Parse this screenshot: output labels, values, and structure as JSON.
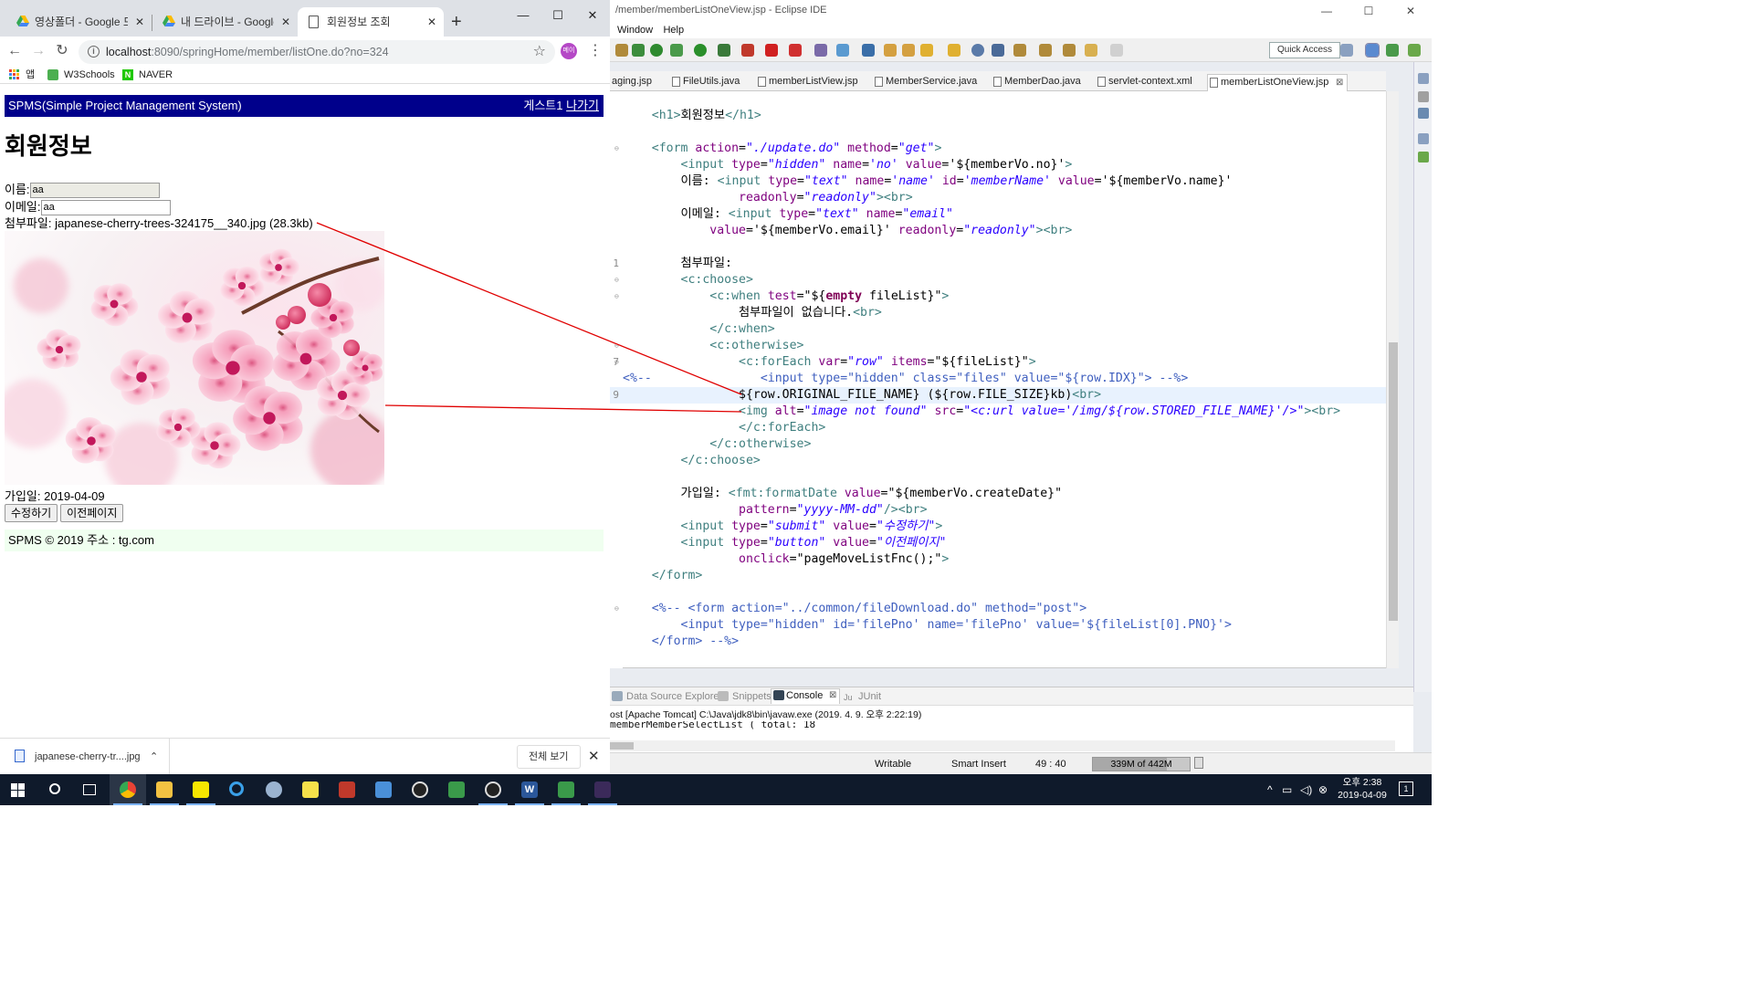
{
  "eclipse": {
    "window_title": "/member/memberListOneView.jsp - Eclipse IDE",
    "menu": [
      "Window",
      "Help"
    ],
    "quick_access": "Quick Access",
    "editor_tabs": [
      "aging.jsp",
      "FileUtils.java",
      "memberListView.jsp",
      "MemberService.java",
      "MemberDao.java",
      "servlet-context.xml",
      "memberListOneView.jsp"
    ],
    "code_lines": [
      {
        "num": "",
        "fold": false,
        "cur": false,
        "segs": [
          [
            "    ",
            "t-el"
          ],
          [
            "<h1>",
            "t-tag"
          ],
          [
            "회원정보",
            "t-el"
          ],
          [
            "</h1>",
            "t-tag"
          ]
        ]
      },
      {
        "num": "",
        "fold": false,
        "cur": false,
        "segs": []
      },
      {
        "num": "",
        "fold": true,
        "cur": false,
        "segs": [
          [
            "    ",
            "t-el"
          ],
          [
            "<form ",
            "t-tag"
          ],
          [
            "action",
            "t-attr"
          ],
          [
            "=",
            "t-el"
          ],
          [
            "\"./update.do\"",
            "t-str"
          ],
          [
            " method",
            "t-attr"
          ],
          [
            "=",
            "t-el"
          ],
          [
            "\"get\"",
            "t-str"
          ],
          [
            ">",
            "t-tag"
          ]
        ]
      },
      {
        "num": "",
        "fold": false,
        "cur": false,
        "segs": [
          [
            "        ",
            "t-el"
          ],
          [
            "<input ",
            "t-tag"
          ],
          [
            "type",
            "t-attr"
          ],
          [
            "=",
            "t-el"
          ],
          [
            "\"hidden\"",
            "t-str"
          ],
          [
            " name",
            "t-attr"
          ],
          [
            "=",
            "t-el"
          ],
          [
            "'no'",
            "t-str"
          ],
          [
            " value",
            "t-attr"
          ],
          [
            "=",
            "t-el"
          ],
          [
            "'${memberVo.no}'",
            "t-el"
          ],
          [
            ">",
            "t-tag"
          ]
        ]
      },
      {
        "num": "",
        "fold": false,
        "cur": false,
        "segs": [
          [
            "        이름: ",
            "t-el"
          ],
          [
            "<input ",
            "t-tag"
          ],
          [
            "type",
            "t-attr"
          ],
          [
            "=",
            "t-el"
          ],
          [
            "\"text\"",
            "t-str"
          ],
          [
            " name",
            "t-attr"
          ],
          [
            "=",
            "t-el"
          ],
          [
            "'name'",
            "t-str"
          ],
          [
            " id",
            "t-attr"
          ],
          [
            "=",
            "t-el"
          ],
          [
            "'memberName'",
            "t-str"
          ],
          [
            " value",
            "t-attr"
          ],
          [
            "=",
            "t-el"
          ],
          [
            "'${memberVo.name}'",
            "t-el"
          ]
        ]
      },
      {
        "num": "",
        "fold": false,
        "cur": false,
        "segs": [
          [
            "                ",
            "t-el"
          ],
          [
            "readonly",
            "t-attr"
          ],
          [
            "=",
            "t-el"
          ],
          [
            "\"readonly\"",
            "t-str"
          ],
          [
            ">",
            "t-tag"
          ],
          [
            "<br>",
            "t-tag"
          ]
        ]
      },
      {
        "num": "",
        "fold": false,
        "cur": false,
        "segs": [
          [
            "        이메일: ",
            "t-el"
          ],
          [
            "<input ",
            "t-tag"
          ],
          [
            "type",
            "t-attr"
          ],
          [
            "=",
            "t-el"
          ],
          [
            "\"text\"",
            "t-str"
          ],
          [
            " name",
            "t-attr"
          ],
          [
            "=",
            "t-el"
          ],
          [
            "\"email\"",
            "t-str"
          ]
        ]
      },
      {
        "num": "",
        "fold": false,
        "cur": false,
        "segs": [
          [
            "            ",
            "t-el"
          ],
          [
            "value",
            "t-attr"
          ],
          [
            "=",
            "t-el"
          ],
          [
            "'${memberVo.email}'",
            "t-el"
          ],
          [
            " readonly",
            "t-attr"
          ],
          [
            "=",
            "t-el"
          ],
          [
            "\"readonly\"",
            "t-str"
          ],
          [
            ">",
            "t-tag"
          ],
          [
            "<br>",
            "t-tag"
          ]
        ]
      },
      {
        "num": "",
        "fold": false,
        "cur": false,
        "segs": []
      },
      {
        "num": "1",
        "fold": false,
        "cur": false,
        "segs": [
          [
            "        첨부파일:",
            "t-el"
          ]
        ]
      },
      {
        "num": "",
        "fold": true,
        "cur": false,
        "segs": [
          [
            "        ",
            "t-el"
          ],
          [
            "<c:choose>",
            "t-tag"
          ]
        ]
      },
      {
        "num": "",
        "fold": true,
        "cur": false,
        "segs": [
          [
            "            ",
            "t-el"
          ],
          [
            "<c:when ",
            "t-tag"
          ],
          [
            "test",
            "t-attr"
          ],
          [
            "=",
            "t-el"
          ],
          [
            "\"${",
            "t-el"
          ],
          [
            "empty",
            "t-kw"
          ],
          [
            " fileList}\"",
            "t-el"
          ],
          [
            ">",
            "t-tag"
          ]
        ]
      },
      {
        "num": "",
        "fold": false,
        "cur": false,
        "segs": [
          [
            "                첨부파일이 없습니다.",
            "t-el"
          ],
          [
            "<br>",
            "t-tag"
          ]
        ]
      },
      {
        "num": "",
        "fold": false,
        "cur": false,
        "segs": [
          [
            "            ",
            "t-el"
          ],
          [
            "</c:when>",
            "t-tag"
          ]
        ]
      },
      {
        "num": "",
        "fold": true,
        "cur": false,
        "segs": [
          [
            "            ",
            "t-el"
          ],
          [
            "<c:otherwise>",
            "t-tag"
          ]
        ]
      },
      {
        "num": "7",
        "fold": true,
        "cur": false,
        "segs": [
          [
            "                ",
            "t-el"
          ],
          [
            "<c:forEach ",
            "t-tag"
          ],
          [
            "var",
            "t-attr"
          ],
          [
            "=",
            "t-el"
          ],
          [
            "\"row\"",
            "t-str"
          ],
          [
            " items",
            "t-attr"
          ],
          [
            "=",
            "t-el"
          ],
          [
            "\"${fileList}\"",
            "t-el"
          ],
          [
            ">",
            "t-tag"
          ]
        ]
      },
      {
        "num": "",
        "fold": false,
        "cur": false,
        "segs": [
          [
            "<%--               ",
            "t-cm"
          ],
          [
            "<input type=\"hidden\" class=\"files\" value=\"${row.IDX}\"> --%>",
            "t-cm"
          ]
        ]
      },
      {
        "num": "9",
        "fold": false,
        "cur": true,
        "segs": [
          [
            "                ",
            "t-el"
          ],
          [
            "${row.ORIGINAL_FILE_NAME} (${row.FILE_SIZE}kb)",
            "t-el"
          ],
          [
            "<br>",
            "t-tag"
          ]
        ]
      },
      {
        "num": "",
        "fold": false,
        "cur": false,
        "segs": [
          [
            "                ",
            "t-el"
          ],
          [
            "<img ",
            "t-tag"
          ],
          [
            "alt",
            "t-attr"
          ],
          [
            "=",
            "t-el"
          ],
          [
            "\"image not found\"",
            "t-str"
          ],
          [
            " src",
            "t-attr"
          ],
          [
            "=",
            "t-el"
          ],
          [
            "\"<c:url value='/img/${row.STORED_FILE_NAME}'/>\"",
            "t-str"
          ],
          [
            "><br>",
            "t-tag"
          ]
        ]
      },
      {
        "num": "",
        "fold": false,
        "cur": false,
        "segs": [
          [
            "                ",
            "t-el"
          ],
          [
            "</c:forEach>",
            "t-tag"
          ]
        ]
      },
      {
        "num": "",
        "fold": false,
        "cur": false,
        "segs": [
          [
            "            ",
            "t-el"
          ],
          [
            "</c:otherwise>",
            "t-tag"
          ]
        ]
      },
      {
        "num": "",
        "fold": false,
        "cur": false,
        "segs": [
          [
            "        ",
            "t-el"
          ],
          [
            "</c:choose>",
            "t-tag"
          ]
        ]
      },
      {
        "num": "",
        "fold": false,
        "cur": false,
        "segs": []
      },
      {
        "num": "",
        "fold": false,
        "cur": false,
        "segs": [
          [
            "        가입일: ",
            "t-el"
          ],
          [
            "<fmt:formatDate ",
            "t-tag"
          ],
          [
            "value",
            "t-attr"
          ],
          [
            "=",
            "t-el"
          ],
          [
            "\"${memberVo.createDate}\"",
            "t-el"
          ]
        ]
      },
      {
        "num": "",
        "fold": false,
        "cur": false,
        "segs": [
          [
            "                ",
            "t-el"
          ],
          [
            "pattern",
            "t-attr"
          ],
          [
            "=",
            "t-el"
          ],
          [
            "\"yyyy-MM-dd\"",
            "t-str"
          ],
          [
            "/>",
            "t-tag"
          ],
          [
            "<br>",
            "t-tag"
          ]
        ]
      },
      {
        "num": "",
        "fold": false,
        "cur": false,
        "segs": [
          [
            "        ",
            "t-el"
          ],
          [
            "<input ",
            "t-tag"
          ],
          [
            "type",
            "t-attr"
          ],
          [
            "=",
            "t-el"
          ],
          [
            "\"submit\"",
            "t-str"
          ],
          [
            " value",
            "t-attr"
          ],
          [
            "=",
            "t-el"
          ],
          [
            "\"수정하기\"",
            "t-str"
          ],
          [
            ">",
            "t-tag"
          ]
        ]
      },
      {
        "num": "",
        "fold": false,
        "cur": false,
        "segs": [
          [
            "        ",
            "t-el"
          ],
          [
            "<input ",
            "t-tag"
          ],
          [
            "type",
            "t-attr"
          ],
          [
            "=",
            "t-el"
          ],
          [
            "\"button\"",
            "t-str"
          ],
          [
            " value",
            "t-attr"
          ],
          [
            "=",
            "t-el"
          ],
          [
            "\"이전페이지\"",
            "t-str"
          ]
        ]
      },
      {
        "num": "",
        "fold": false,
        "cur": false,
        "segs": [
          [
            "                ",
            "t-el"
          ],
          [
            "onclick",
            "t-attr"
          ],
          [
            "=",
            "t-el"
          ],
          [
            "\"pageMoveListFnc();\"",
            "t-el"
          ],
          [
            ">",
            "t-tag"
          ]
        ]
      },
      {
        "num": "",
        "fold": false,
        "cur": false,
        "segs": [
          [
            "    ",
            "t-el"
          ],
          [
            "</form>",
            "t-tag"
          ]
        ]
      },
      {
        "num": "",
        "fold": false,
        "cur": false,
        "segs": []
      },
      {
        "num": "",
        "fold": true,
        "cur": false,
        "segs": [
          [
            "    ",
            "t-el"
          ],
          [
            "<%-- <form action=\"../common/fileDownload.do\" method=\"post\">",
            "t-cm"
          ]
        ]
      },
      {
        "num": "",
        "fold": false,
        "cur": false,
        "segs": [
          [
            "        ",
            "t-el"
          ],
          [
            "<input type=\"hidden\" id='filePno' name='filePno' value='${fileList[0].PNO}'>",
            "t-cm"
          ]
        ]
      },
      {
        "num": "",
        "fold": false,
        "cur": false,
        "segs": [
          [
            "    ",
            "t-el"
          ],
          [
            "</form> --%>",
            "t-cm"
          ]
        ]
      }
    ],
    "console": {
      "tabs": [
        "Data Source Explorer",
        "Snippets",
        "Console",
        "JUnit"
      ],
      "process": "ost [Apache Tomcat] C:\\Java\\jdk8\\bin\\javaw.exe (2019. 4. 9. 오후 2:22:19)",
      "output": "memberMemberSelectList   (       total: 18"
    },
    "status": {
      "writable": "Writable",
      "insert_mode": "Smart Insert",
      "cursor": "49 : 40",
      "heap": "339M of 442M",
      "heap_used_fraction": 0.767
    }
  },
  "chrome": {
    "tabs": [
      "영상폴더 - Google 드라이브",
      "내 드라이브 - Google 드라이브",
      "회원정보 조회"
    ],
    "url_host": "localhost",
    "url_rest": ":8090/springHome/member/listOne.do?no=324",
    "profile_initial": "메이",
    "bookmarks": [
      "앱",
      "W3Schools",
      "NAVER"
    ],
    "page": {
      "header_brand": "SPMS(Simple Project Management System)",
      "header_user": "게스트1",
      "header_logout": "나가기",
      "title": "회원정보",
      "name_label": "이름:",
      "name_value": "aa",
      "email_label": "이메일:",
      "email_value": "aa",
      "attach_label": "첨부파일:",
      "attach_text": "japanese-cherry-trees-324175__340.jpg (28.3kb)",
      "join_label": "가입일:",
      "join_date": "2019-04-09",
      "edit_button": "수정하기",
      "prev_button": "이전페이지",
      "footer": "SPMS © 2019 주소 : tg.com"
    },
    "download": {
      "file": "japanese-cherry-tr....jpg",
      "show_all": "전체 보기"
    }
  },
  "taskbar": {
    "time": "오후 2:38",
    "date": "2019-04-09",
    "notifications": "1"
  },
  "colors": {
    "spms_header": "#00008b",
    "annotation_line": "#e00000",
    "taskbar": "#0f1a2b"
  }
}
